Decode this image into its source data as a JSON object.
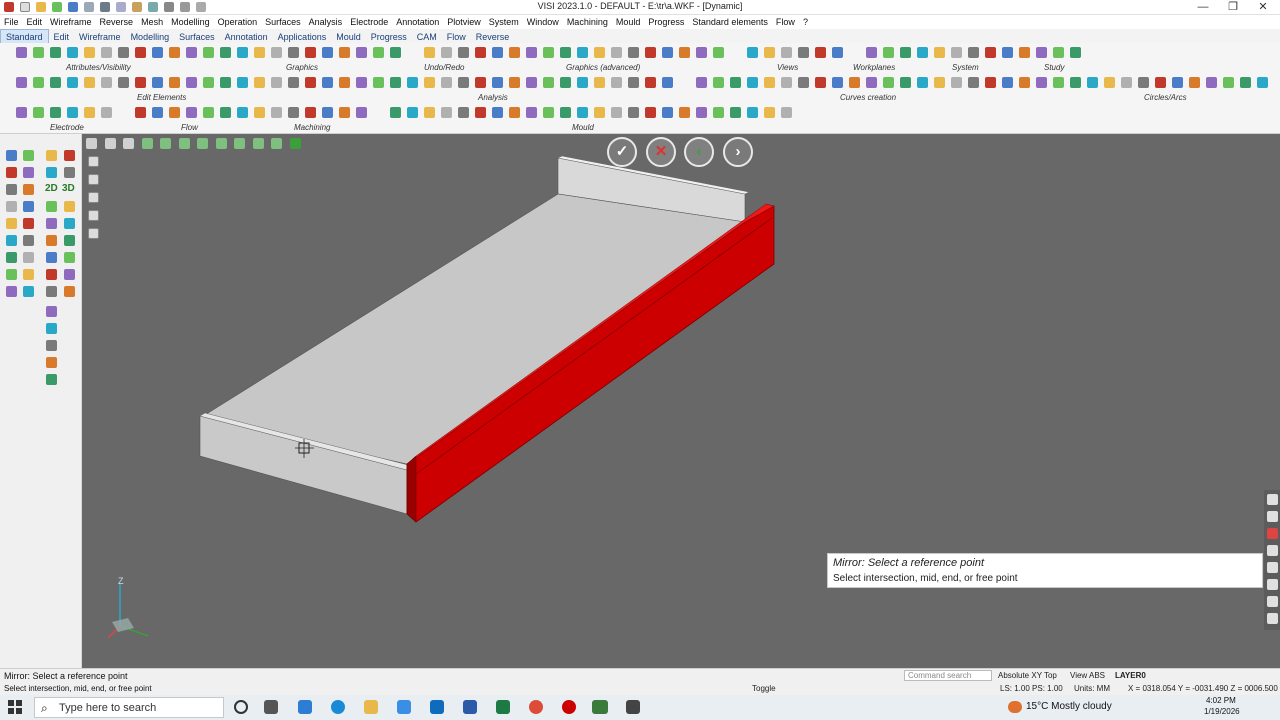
{
  "window": {
    "title": "VISI 2023.1.0 - DEFAULT - E:\\tr\\a.WKF - [Dynamic]",
    "controls": [
      "—",
      "❐",
      "✕"
    ]
  },
  "menu": [
    "File",
    "Edit",
    "Wireframe",
    "Reverse",
    "Mesh",
    "Modelling",
    "Operation",
    "Surfaces",
    "Analysis",
    "Electrode",
    "Annotation",
    "Plotview",
    "System",
    "Window",
    "Machining",
    "Mould",
    "Progress",
    "Standard elements",
    "Flow",
    "?"
  ],
  "tabs": [
    "Standard",
    "Edit",
    "Wireframe",
    "Modelling",
    "Surfaces",
    "Annotation",
    "Applications",
    "Mould",
    "Progress",
    "CAM",
    "Flow",
    "Reverse"
  ],
  "active_tab": "Standard",
  "ribbon_groups": {
    "attributes": "Attributes/Visibility",
    "graphics": "Graphics",
    "undo": "Undo/Redo",
    "graphics_adv": "Graphics (advanced)",
    "views": "Views",
    "workplanes": "Workplanes",
    "system": "System",
    "study": "Study",
    "edit_elements": "Edit Elements",
    "analysis": "Analysis",
    "curves": "Curves creation",
    "circles": "Circles/Arcs",
    "electrode": "Electrode",
    "flow": "Flow",
    "machining": "Machining",
    "mould": "Mould"
  },
  "view_labels": {
    "d2": "2D",
    "d3": "3D"
  },
  "prompt": {
    "title": "Mirror: Select a reference point",
    "subtitle": "Select intersection, mid, end, or free point"
  },
  "triad": {
    "axis_label": "Z"
  },
  "status": {
    "line1": "Mirror: Select a reference point",
    "line2": "Select intersection, mid, end, or free point",
    "toggle": "Toggle",
    "command_search": "Command search",
    "workplane": "Absolute XY Top",
    "view": "View ABS",
    "layer": "LAYER0",
    "scale": "LS: 1.00 PS: 1.00",
    "units": "Units: MM",
    "coords": "X = 0318.054 Y = -0031.490 Z = 0006.500"
  },
  "taskbar": {
    "search_placeholder": "Type here to search",
    "weather": "15°C  Mostly cloudy",
    "time": "4:02 PM",
    "date": "1/19/2026"
  },
  "colors": {
    "highlight": "#d40000",
    "viewport": "#686868",
    "accent": "#1a3f7a"
  }
}
